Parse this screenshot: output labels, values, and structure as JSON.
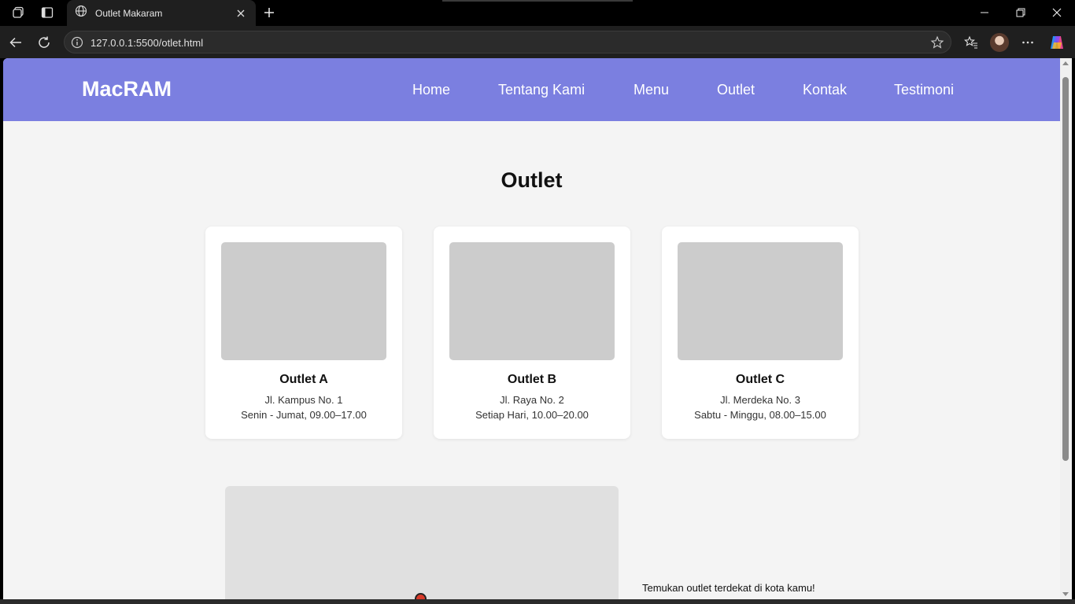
{
  "browser": {
    "tab_title": "Outlet Makaram",
    "url": "127.0.0.1:5500/otlet.html"
  },
  "site": {
    "brand": "MacRAM",
    "nav": [
      "Home",
      "Tentang Kami",
      "Menu",
      "Outlet",
      "Kontak",
      "Testimoni"
    ]
  },
  "page": {
    "heading": "Outlet",
    "outlets": [
      {
        "name": "Outlet A",
        "address": "Jl. Kampus No. 1",
        "hours": "Senin - Jumat, 09.00–17.00"
      },
      {
        "name": "Outlet B",
        "address": "Jl. Raya No. 2",
        "hours": "Setiap Hari, 10.00–20.00"
      },
      {
        "name": "Outlet C",
        "address": "Jl. Merdeka No. 3",
        "hours": "Sabtu - Minggu, 08.00–15.00"
      }
    ],
    "map_text": "Temukan outlet terdekat di kota kamu!"
  },
  "colors": {
    "header_bg": "#7b7fe0",
    "page_bg": "#f4f4f4",
    "placeholder": "#cccccc",
    "map_pin": "#d83a2a"
  }
}
